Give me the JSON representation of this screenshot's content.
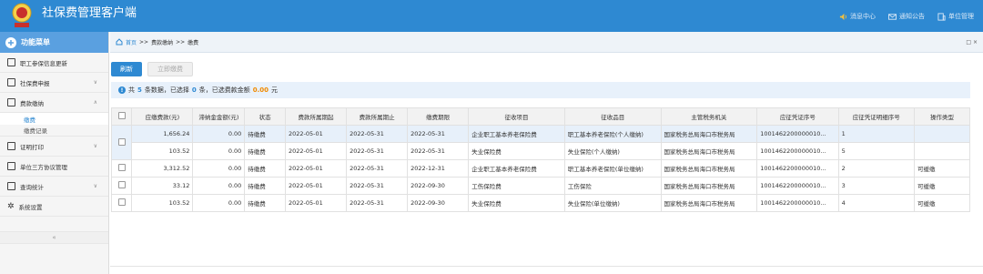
{
  "header": {
    "title": "社保费管理客户端",
    "logo_icon": "tax-emblem",
    "links": [
      {
        "label": "消息中心",
        "icon": "speaker-icon"
      },
      {
        "label": "通知公告",
        "icon": "mail-icon"
      },
      {
        "label": "单位管理",
        "icon": "building-icon"
      }
    ],
    "color": "#2e89d2"
  },
  "sidebar": {
    "title": "功能菜单",
    "items": [
      {
        "label": "职工参保信息更新"
      },
      {
        "label": "社保费申报"
      },
      {
        "label": "费款缴纳"
      },
      {
        "label": "证明打印"
      },
      {
        "label": "单位三方协议管理"
      },
      {
        "label": "查询统计"
      },
      {
        "label": "系统设置"
      }
    ],
    "sub_items": [
      {
        "label": "缴费"
      },
      {
        "label": "缴费记录"
      }
    ],
    "collapse_glyph": "«"
  },
  "breadcrumb": {
    "home": "首页",
    "sep1": ">>",
    "section": "费款缴纳",
    "sep2": ">>",
    "current": "缴费",
    "controls": "□ ×"
  },
  "toolbar": {
    "refresh_label": "刷新",
    "pay_label": "立即缴费"
  },
  "notice": {
    "prefix": "共",
    "count": "5",
    "mid1": "条数据，已选择",
    "selected": "0",
    "mid2": "条，已选费款金额",
    "amount": "0.00",
    "suffix": "元"
  },
  "table": {
    "columns": [
      "应缴费款(元)",
      "滞纳金金额(元)",
      "状态",
      "费款所属期起",
      "费款所属期止",
      "缴费期限",
      "征收项目",
      "征收品目",
      "主管税务机关",
      "应征凭证序号",
      "应征凭证明细序号",
      "操作类型"
    ],
    "rows": [
      [
        "1,656.24",
        "0.00",
        "待缴费",
        "2022-05-01",
        "2022-05-31",
        "2022-05-31",
        "企业职工基本养老保险费",
        "职工基本养老保险(个人缴纳)",
        "国家税务总局海口市税务局",
        "1001462200000010...",
        "1",
        ""
      ],
      [
        "103.52",
        "0.00",
        "待缴费",
        "2022-05-01",
        "2022-05-31",
        "2022-05-31",
        "失业保险费",
        "失业保险(个人缴纳)",
        "国家税务总局海口市税务局",
        "1001462200000010...",
        "5",
        ""
      ],
      [
        "3,312.52",
        "0.00",
        "待缴费",
        "2022-05-01",
        "2022-05-31",
        "2022-12-31",
        "企业职工基本养老保险费",
        "职工基本养老保险(单位缴纳)",
        "国家税务总局海口市税务局",
        "1001462200000010...",
        "2",
        "可缓缴"
      ],
      [
        "33.12",
        "0.00",
        "待缴费",
        "2022-05-01",
        "2022-05-31",
        "2022-09-30",
        "工伤保险费",
        "工伤保险",
        "国家税务总局海口市税务局",
        "1001462200000010...",
        "3",
        "可缓缴"
      ],
      [
        "103.52",
        "0.00",
        "待缴费",
        "2022-05-01",
        "2022-05-31",
        "2022-09-30",
        "失业保险费",
        "失业保险(单位缴纳)",
        "国家税务总局海口市税务局",
        "1001462200000010...",
        "4",
        "可缓缴"
      ]
    ]
  }
}
